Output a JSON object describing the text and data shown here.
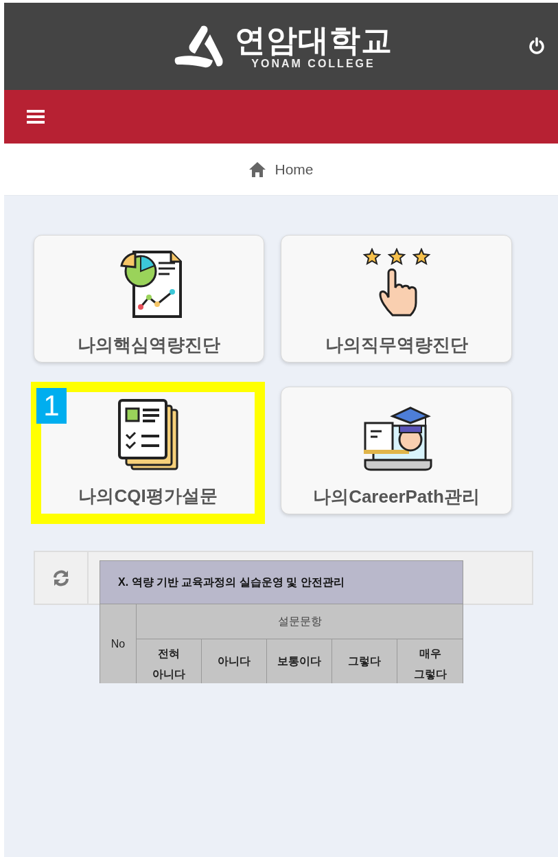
{
  "header": {
    "logo_title": "연암대학교",
    "logo_subtitle": "YONAM COLLEGE"
  },
  "breadcrumb": {
    "label": "Home"
  },
  "tiles": [
    {
      "kind": "core",
      "label": "나의핵심역량진단",
      "highlighted": false
    },
    {
      "kind": "job",
      "label": "나의직무역량진단",
      "highlighted": false
    },
    {
      "kind": "cqi",
      "label": "나의CQI평가설문",
      "highlighted": true,
      "badge": "1"
    },
    {
      "kind": "career",
      "label": "나의CareerPath관리",
      "highlighted": false
    }
  ],
  "survey_table": {
    "title": "X. 역량 기반 교육과정의 실습운영 및 안전관리",
    "no_header": "No",
    "group_header": "설문문항",
    "options": [
      "전혀\n아니다",
      "아니다",
      "보통이다",
      "그렇다",
      "매우\n그렇다"
    ]
  }
}
